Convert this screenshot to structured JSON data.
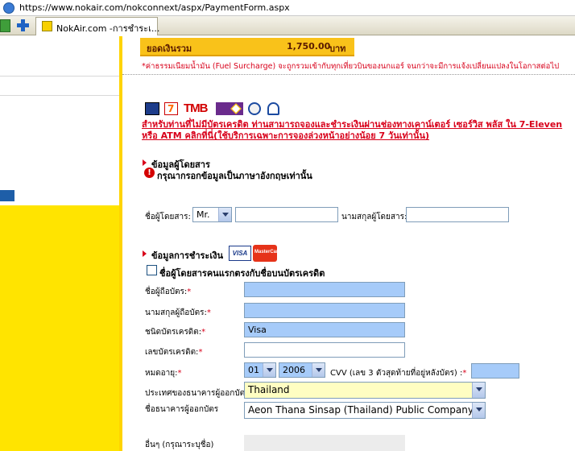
{
  "browser": {
    "url": "https://www.nokair.com/nokconnext/aspx/PaymentForm.aspx",
    "tab_title": "NokAir.com -การชำระเ..."
  },
  "summary": {
    "total_label": "ยอดเงินรวม",
    "total_amount": "1,750.00",
    "currency": "บาท",
    "fuel_note": "*ค่าธรรมเนียมน้ำมัน (Fuel Surcharge) จะถูกรวมเข้ากับทุกเที่ยวบินของนกแอร์ จนกว่าจะมีการแจ้งเปลี่ยนแปลงในโอกาสต่อไป"
  },
  "payment_partners": {
    "tmb_text": "TMB",
    "seven_text": "7",
    "counter_note": "สำหรับท่านที่ไม่มีบัตรเครดิต ท่านสามารถจองและชำระเงินผ่านช่องทางเคาน์เตอร์ เซอร์วิส พลัส ใน 7-Eleven หรือ ATM คลิกที่นี่(ใช้บริการเฉพาะการจองล่วงหน้าอย่างน้อย 7 วันเท่านั้น)"
  },
  "passenger": {
    "section_title": "ข้อมูลผู้โดยสาร",
    "warning": "กรุณากรอกข้อมูลเป็นภาษาอังกฤษเท่านั้น",
    "firstname_label": "ชื่อผู้โดยสาร:",
    "title_value": "Mr.",
    "lastname_label": "นามสกุลผู้โดยสาร:"
  },
  "payment": {
    "section_title": "ข้อมูลการชำระเงิน",
    "visa_text": "VISA",
    "mastercard_text": "MasterCard",
    "same_as_holder_label": "ชื่อผู้โดยสารคนแรกตรงกับชื่อบนบัตรเครดิต",
    "holder_first_label": "ชื่อผู้ถือบัตร:",
    "holder_last_label": "นามสกุลผู้ถือบัตร:",
    "card_type_label": "ชนิดบัตรเครดิต:",
    "card_type_value": "Visa",
    "card_number_label": "เลขบัตรเครดิต:",
    "expiry_label": "หมดอายุ:",
    "expiry_month": "01",
    "expiry_year": "2006",
    "cvv_label": "CVV (เลข 3 ตัวสุดท้ายที่อยู่หลังบัตร) :",
    "required_mark": "*",
    "country_label": "ประเทศของธนาคารผู้ออกบัตร",
    "country_value": "Thailand",
    "bank_label": "ชื่อธนาคารผู้ออกบัตร",
    "bank_value": "Aeon Thana Sinsap (Thailand) Public Company Limited",
    "other_label": "อื่นๆ (กรุณาระบุชื่อ)"
  },
  "colors": {
    "accent_yellow": "#ffe400",
    "total_bar": "#f9c21a",
    "alert_red": "#d8001a",
    "field_blue": "#a6cbf9",
    "field_yellow": "#fffec2"
  }
}
